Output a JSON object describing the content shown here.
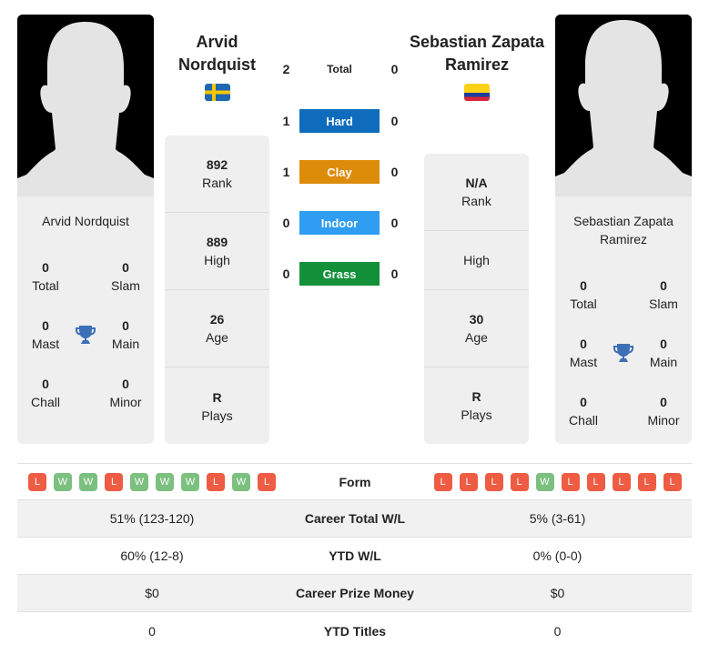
{
  "player1": {
    "name": "Arvid Nordquist",
    "name_line1": "Arvid",
    "name_line2": "Nordquist",
    "flag": "sweden-flag",
    "titles": {
      "total": {
        "value": "0",
        "label": "Total"
      },
      "slam": {
        "value": "0",
        "label": "Slam"
      },
      "mast": {
        "value": "0",
        "label": "Mast"
      },
      "main": {
        "value": "0",
        "label": "Main"
      },
      "chall": {
        "value": "0",
        "label": "Chall"
      },
      "minor": {
        "value": "0",
        "label": "Minor"
      }
    },
    "stats": [
      {
        "value": "892",
        "label": "Rank"
      },
      {
        "value": "889",
        "label": "High"
      },
      {
        "value": "26",
        "label": "Age"
      },
      {
        "value": "R",
        "label": "Plays"
      }
    ],
    "form": [
      "L",
      "W",
      "W",
      "L",
      "W",
      "W",
      "W",
      "L",
      "W",
      "L"
    ]
  },
  "player2": {
    "name": "Sebastian Zapata Ramirez",
    "name_line1": "Sebastian Zapata",
    "name_line2": "Ramirez",
    "flag": "colombia-flag",
    "titles": {
      "total": {
        "value": "0",
        "label": "Total"
      },
      "slam": {
        "value": "0",
        "label": "Slam"
      },
      "mast": {
        "value": "0",
        "label": "Mast"
      },
      "main": {
        "value": "0",
        "label": "Main"
      },
      "chall": {
        "value": "0",
        "label": "Chall"
      },
      "minor": {
        "value": "0",
        "label": "Minor"
      }
    },
    "stats": [
      {
        "value": "N/A",
        "label": "Rank"
      },
      {
        "value": "",
        "label": "High"
      },
      {
        "value": "30",
        "label": "Age"
      },
      {
        "value": "R",
        "label": "Plays"
      }
    ],
    "form": [
      "L",
      "L",
      "L",
      "L",
      "W",
      "L",
      "L",
      "L",
      "L",
      "L"
    ]
  },
  "h2h": [
    {
      "label": "Total",
      "p1": "2",
      "p2": "0",
      "color": ""
    },
    {
      "label": "Hard",
      "p1": "1",
      "p2": "0",
      "color": "#0f6cbd"
    },
    {
      "label": "Clay",
      "p1": "1",
      "p2": "0",
      "color": "#dd8c0a"
    },
    {
      "label": "Indoor",
      "p1": "0",
      "p2": "0",
      "color": "#2e9df2"
    },
    {
      "label": "Grass",
      "p1": "0",
      "p2": "0",
      "color": "#12903a"
    }
  ],
  "comparison": {
    "form_label": "Form",
    "rows": [
      {
        "label": "Career Total W/L",
        "p1": "51% (123-120)",
        "p2": "5% (3-61)"
      },
      {
        "label": "YTD W/L",
        "p1": "60% (12-8)",
        "p2": "0% (0-0)"
      },
      {
        "label": "Career Prize Money",
        "p1": "$0",
        "p2": "$0"
      },
      {
        "label": "YTD Titles",
        "p1": "0",
        "p2": "0"
      }
    ]
  }
}
